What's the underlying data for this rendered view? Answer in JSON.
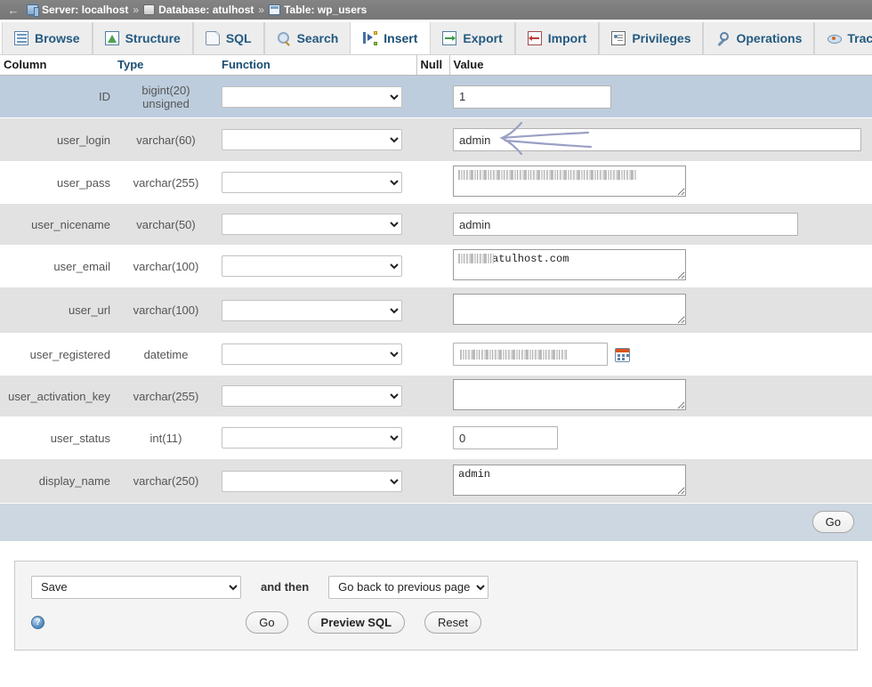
{
  "breadcrumb": {
    "back_label": "←",
    "server_icon": "server-icon",
    "server_label": "Server: localhost",
    "sep1": "»",
    "database_icon": "database-icon",
    "database_label": "Database: atulhost",
    "sep2": "»",
    "table_icon": "table-icon",
    "table_label": "Table: wp_users"
  },
  "tabs": [
    {
      "label": "Browse",
      "icon": "browse-icon",
      "active": false
    },
    {
      "label": "Structure",
      "icon": "structure-icon",
      "active": false
    },
    {
      "label": "SQL",
      "icon": "sql-icon",
      "active": false
    },
    {
      "label": "Search",
      "icon": "search-icon",
      "active": false
    },
    {
      "label": "Insert",
      "icon": "insert-icon",
      "active": true
    },
    {
      "label": "Export",
      "icon": "export-icon",
      "active": false
    },
    {
      "label": "Import",
      "icon": "import-icon",
      "active": false
    },
    {
      "label": "Privileges",
      "icon": "privileges-icon",
      "active": false
    },
    {
      "label": "Operations",
      "icon": "operations-icon",
      "active": false
    },
    {
      "label": "Tracking",
      "icon": "tracking-icon",
      "active": false
    },
    {
      "label": "",
      "icon": "triggers-icon",
      "active": false
    }
  ],
  "table_headers": {
    "column": "Column",
    "type": "Type",
    "function": "Function",
    "null": "Null",
    "value": "Value"
  },
  "rows": [
    {
      "column": "ID",
      "type": "bigint(20) unsigned",
      "function": "",
      "null": "",
      "value": "1",
      "field_kind": "input",
      "field_width": 178,
      "redacted": false,
      "highlighted": true
    },
    {
      "column": "user_login",
      "type": "varchar(60)",
      "function": "",
      "null": "",
      "value": "admin",
      "field_kind": "input",
      "field_width": 459,
      "redacted": false,
      "highlighted": false
    },
    {
      "column": "user_pass",
      "type": "varchar(255)",
      "function": "",
      "null": "",
      "value": "",
      "field_kind": "textarea",
      "field_width": 262,
      "redacted": true,
      "redact_width": 200,
      "highlighted": false
    },
    {
      "column": "user_nicename",
      "type": "varchar(50)",
      "function": "",
      "null": "",
      "value": "admin",
      "field_kind": "input",
      "field_width": 388,
      "redacted": false,
      "highlighted": false
    },
    {
      "column": "user_email",
      "type": "varchar(100)",
      "function": "",
      "null": "",
      "value": "atulhost.com",
      "field_kind": "textarea",
      "field_width": 262,
      "redacted": true,
      "redact_width": 40,
      "highlighted": false
    },
    {
      "column": "user_url",
      "type": "varchar(100)",
      "function": "",
      "null": "",
      "value": "",
      "field_kind": "textarea",
      "field_width": 262,
      "redacted": false,
      "highlighted": false
    },
    {
      "column": "user_registered",
      "type": "datetime",
      "function": "",
      "null": "",
      "value": "",
      "field_kind": "input-calendar",
      "field_width": 174,
      "redacted": true,
      "redact_width": 120,
      "highlighted": false
    },
    {
      "column": "user_activation_key",
      "type": "varchar(255)",
      "function": "",
      "null": "",
      "value": "",
      "field_kind": "textarea",
      "field_width": 262,
      "redacted": false,
      "highlighted": false
    },
    {
      "column": "user_status",
      "type": "int(11)",
      "function": "",
      "null": "",
      "value": "0",
      "field_kind": "input",
      "field_width": 118,
      "redacted": false,
      "highlighted": false
    },
    {
      "column": "display_name",
      "type": "varchar(250)",
      "function": "",
      "null": "",
      "value": "admin",
      "field_kind": "textarea",
      "field_width": 262,
      "redacted": false,
      "highlighted": false
    }
  ],
  "table_footer": {
    "go_label": "Go"
  },
  "bottom_panel": {
    "save_select_value": "Save",
    "and_then_label": "and then",
    "then_select_value": "Go back to previous page",
    "help_glyph": "?",
    "go_label": "Go",
    "preview_sql_label": "Preview SQL",
    "reset_label": "Reset"
  },
  "annotation": {
    "type": "hand-drawn-arrow",
    "direction": "left",
    "color": "#9aa0c4",
    "points_to": "user_login value field"
  },
  "colors": {
    "breadcrumb_bg": "#7d7d7d",
    "tab_text": "#235a81",
    "header_text": "#1a4e73",
    "row_even_bg": "#e2e2e2",
    "row_hover_bg": "#bdcddd",
    "go_row_bg": "#ccd7e1",
    "panel_bg": "#f4f4f4",
    "annotation": "#9aa0c4"
  }
}
